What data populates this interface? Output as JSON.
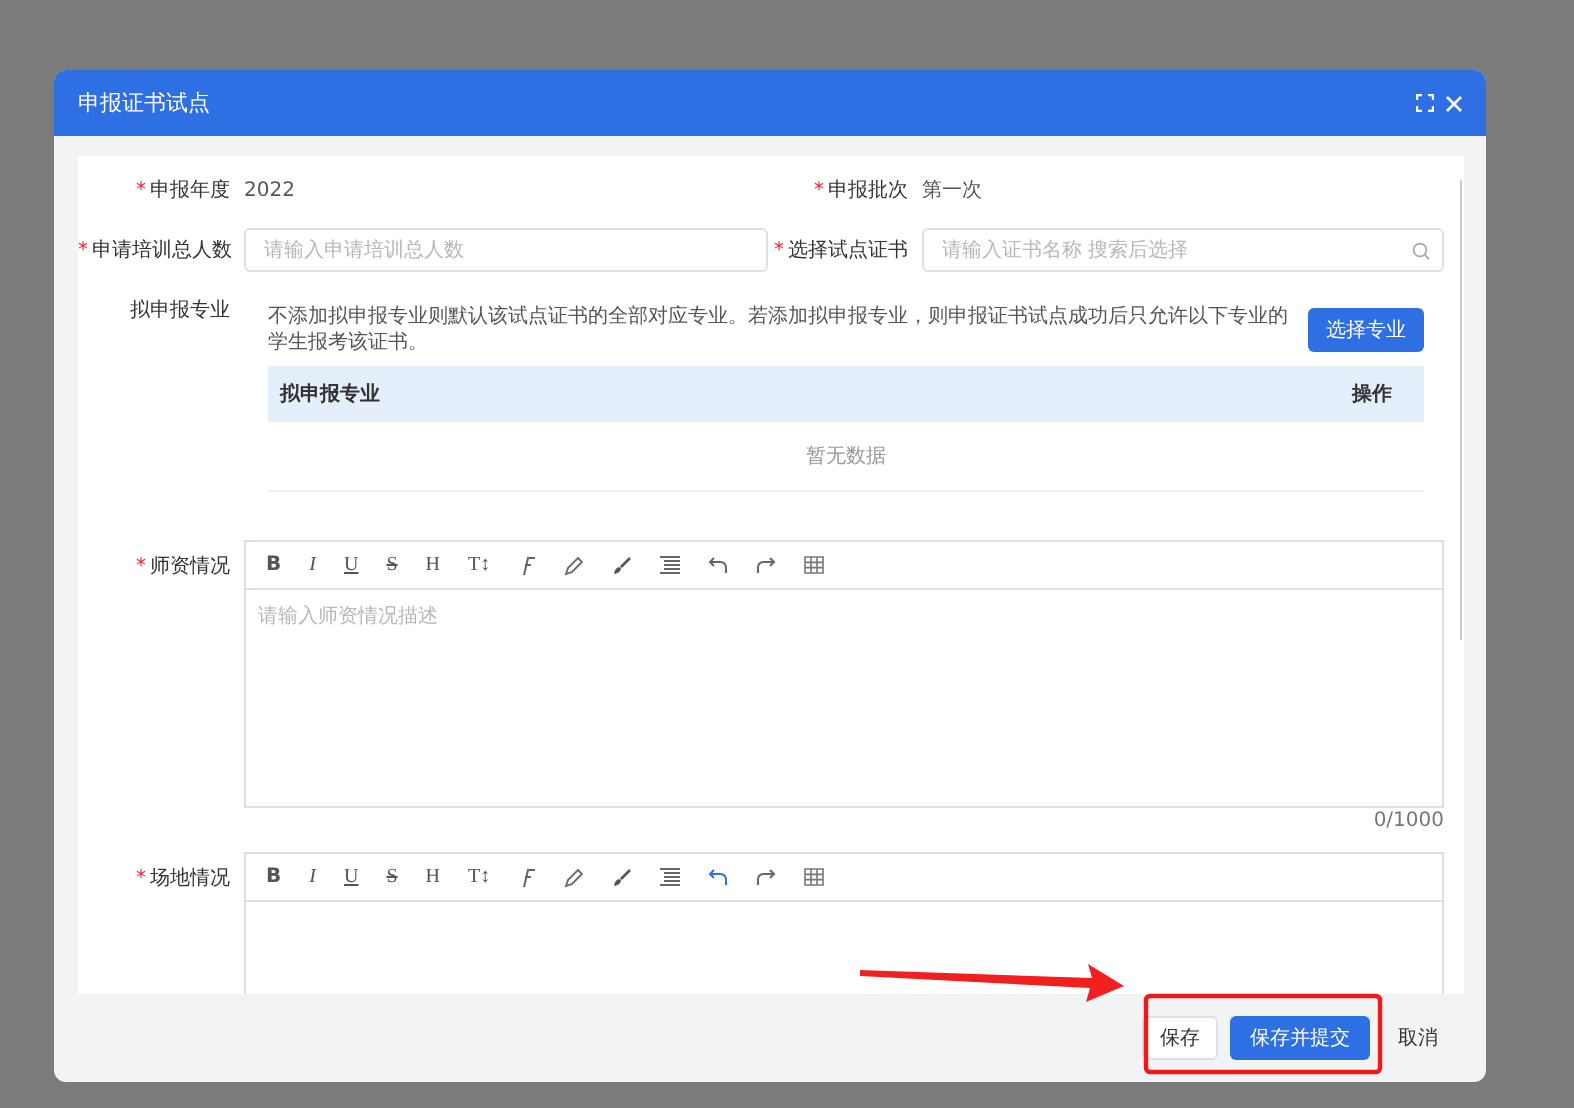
{
  "dialog": {
    "title": "申报证书试点"
  },
  "fields": [
    {
      "label": "申报年度",
      "required_mark": "*",
      "kind": "text",
      "value": "2022"
    },
    {
      "label": "申报批次",
      "required_mark": "*",
      "kind": "text",
      "value": "第一次"
    },
    {
      "label": "申请培训总人数",
      "required_mark": "*",
      "kind": "input",
      "placeholder": "请输入申请培训总人数"
    },
    {
      "label": "选择试点证书",
      "required_mark": "*",
      "kind": "search",
      "placeholder": "请输入证书名称 搜索后选择"
    }
  ],
  "majors": {
    "label": "拟申报专业",
    "note": "不添加拟申报专业则默认该试点证书的全部对应专业。若添加拟申报专业，则申报证书试点成功后只允许以下专业的学生报考该证书。",
    "button": "选择专业",
    "columns": [
      "拟申报专业",
      "操作"
    ],
    "empty_text": "暂无数据"
  },
  "editors": [
    {
      "label": "师资情况",
      "required_mark": "*",
      "placeholder": "请输入师资情况描述",
      "counter": "0/1000",
      "toolbar": [
        {
          "kind": "bold",
          "text": "B"
        },
        {
          "kind": "italic",
          "text": "I"
        },
        {
          "kind": "underline",
          "text": "U"
        },
        {
          "kind": "strike",
          "text": "S"
        },
        {
          "kind": "heading",
          "text": "H"
        },
        {
          "kind": "size",
          "text": "T↕"
        },
        {
          "kind": "clear"
        },
        {
          "kind": "pen"
        },
        {
          "kind": "brush"
        },
        {
          "kind": "align"
        },
        {
          "kind": "undo",
          "active": false
        },
        {
          "kind": "redo",
          "active": false
        },
        {
          "kind": "table"
        }
      ]
    },
    {
      "label": "场地情况",
      "required_mark": "*",
      "toolbar": [
        {
          "kind": "bold",
          "text": "B"
        },
        {
          "kind": "italic",
          "text": "I"
        },
        {
          "kind": "underline",
          "text": "U"
        },
        {
          "kind": "strike",
          "text": "S"
        },
        {
          "kind": "heading",
          "text": "H"
        },
        {
          "kind": "size",
          "text": "T↕"
        },
        {
          "kind": "clear"
        },
        {
          "kind": "pen"
        },
        {
          "kind": "brush"
        },
        {
          "kind": "align"
        },
        {
          "kind": "undo",
          "active": true
        },
        {
          "kind": "redo",
          "active": false
        },
        {
          "kind": "table"
        }
      ]
    }
  ],
  "footer": {
    "buttons": [
      {
        "label": "保存",
        "kind": "default"
      },
      {
        "label": "保存并提交",
        "kind": "primary"
      },
      {
        "label": "取消",
        "kind": "text"
      }
    ]
  }
}
